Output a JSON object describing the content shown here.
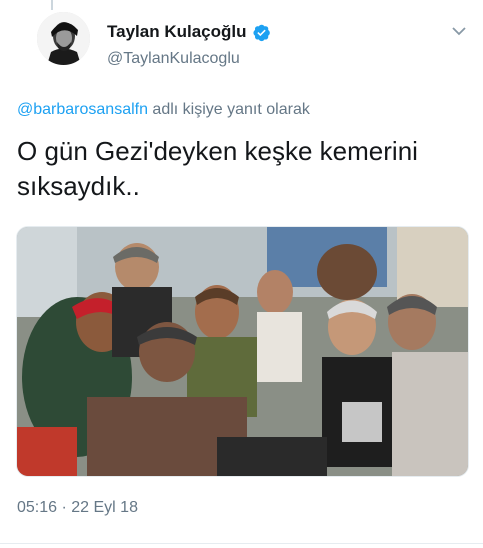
{
  "author": {
    "display_name": "Taylan Kulaçoğlu",
    "handle": "@TaylanKulacoglu",
    "verified": true,
    "avatar_icon": "user-avatar"
  },
  "reply": {
    "mention": "@barbarosansalfn",
    "suffix": " adlı kişiye yanıt olarak"
  },
  "tweet": {
    "text": "O gün Gezi'deyken keşke kemerini sıksaydık.."
  },
  "media": {
    "icon": "crowd-photo"
  },
  "meta": {
    "timestamp": "05:16 · 22 Eyl 18"
  },
  "colors": {
    "accent": "#1da1f2",
    "secondary_text": "#657786",
    "primary_text": "#14171a"
  }
}
